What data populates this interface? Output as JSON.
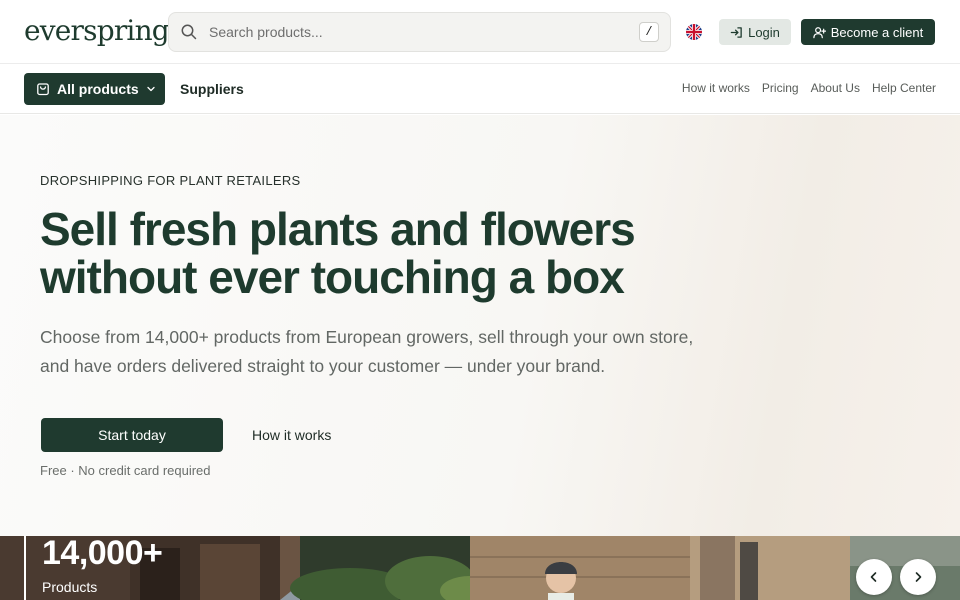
{
  "header": {
    "logo": "everspring",
    "search": {
      "placeholder": "Search products...",
      "shortcut": "/"
    },
    "language_icon": "uk-flag-icon",
    "login_label": "Login",
    "client_label": "Become a client"
  },
  "subnav": {
    "products_label": "All products",
    "suppliers_label": "Suppliers",
    "links": [
      "How it works",
      "Pricing",
      "About Us",
      "Help Center"
    ]
  },
  "hero": {
    "eyebrow": "DROPSHIPPING FOR PLANT RETAILERS",
    "headline_line1": "Sell fresh plants and flowers",
    "headline_line2": "without ever touching a box",
    "subtext": "Choose from 14,000+ products from European growers, sell through your own store, and have orders delivered straight to your customer — under your brand.",
    "primary_cta": "Start today",
    "secondary_cta": "How it works",
    "note": "Free · No credit card required"
  },
  "stats": {
    "value": "14,000+",
    "label": "Products"
  },
  "colors": {
    "brand_green": "#1f3a2f",
    "login_bg": "#e3e8e4",
    "hero_bg": "#f8f7f4"
  }
}
